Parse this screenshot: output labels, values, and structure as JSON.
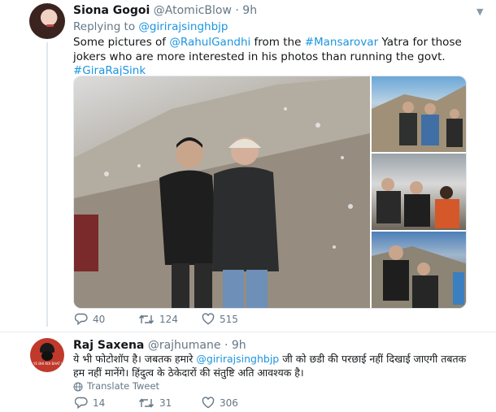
{
  "tweet1": {
    "display_name": "Siona Gogoi",
    "handle": "@AtomicBlow",
    "separator": "·",
    "time": "9h",
    "replying_to_label": "Replying to",
    "replying_to_handle": "@girirajsinghbjp",
    "text": {
      "part1": "Some pictures of ",
      "mention": "@RahulGandhi",
      "part2": " from the ",
      "hashtag1": "#Mansarovar",
      "part3": " Yatra for those jokers who are more interested in his photos than running the govt.",
      "hashtag2": "#GiraRajSink"
    },
    "counts": {
      "replies": "40",
      "retweets": "124",
      "likes": "515"
    }
  },
  "tweet2": {
    "display_name": "Raj Saxena",
    "handle": "@rajhumane",
    "separator": "·",
    "time": "9h",
    "text": {
      "part1": "ये भी फोटोशॉप है। जबतक हमारे ",
      "mention": "@girirajsinghbjp",
      "part2": " जी को छडी की परछाई नहीं दिखाई जाएगी तबतक हम नहीं मानेंगे। हिंदुत्व के ठेकेदारों की संतुष्टि अति आवश्यक है।"
    },
    "translate_label": "Translate Tweet",
    "counts": {
      "replies": "14",
      "retweets": "31",
      "likes": "306"
    },
    "avatar_text": "YE BHI KOI BAAT HAI"
  },
  "icons": [
    "reply-icon",
    "retweet-icon",
    "like-icon",
    "globe-icon",
    "caret-down-icon"
  ],
  "colors": {
    "link": "#1b95e0",
    "muted": "#657786",
    "text": "#14171a",
    "divider": "#e6ecf0"
  }
}
